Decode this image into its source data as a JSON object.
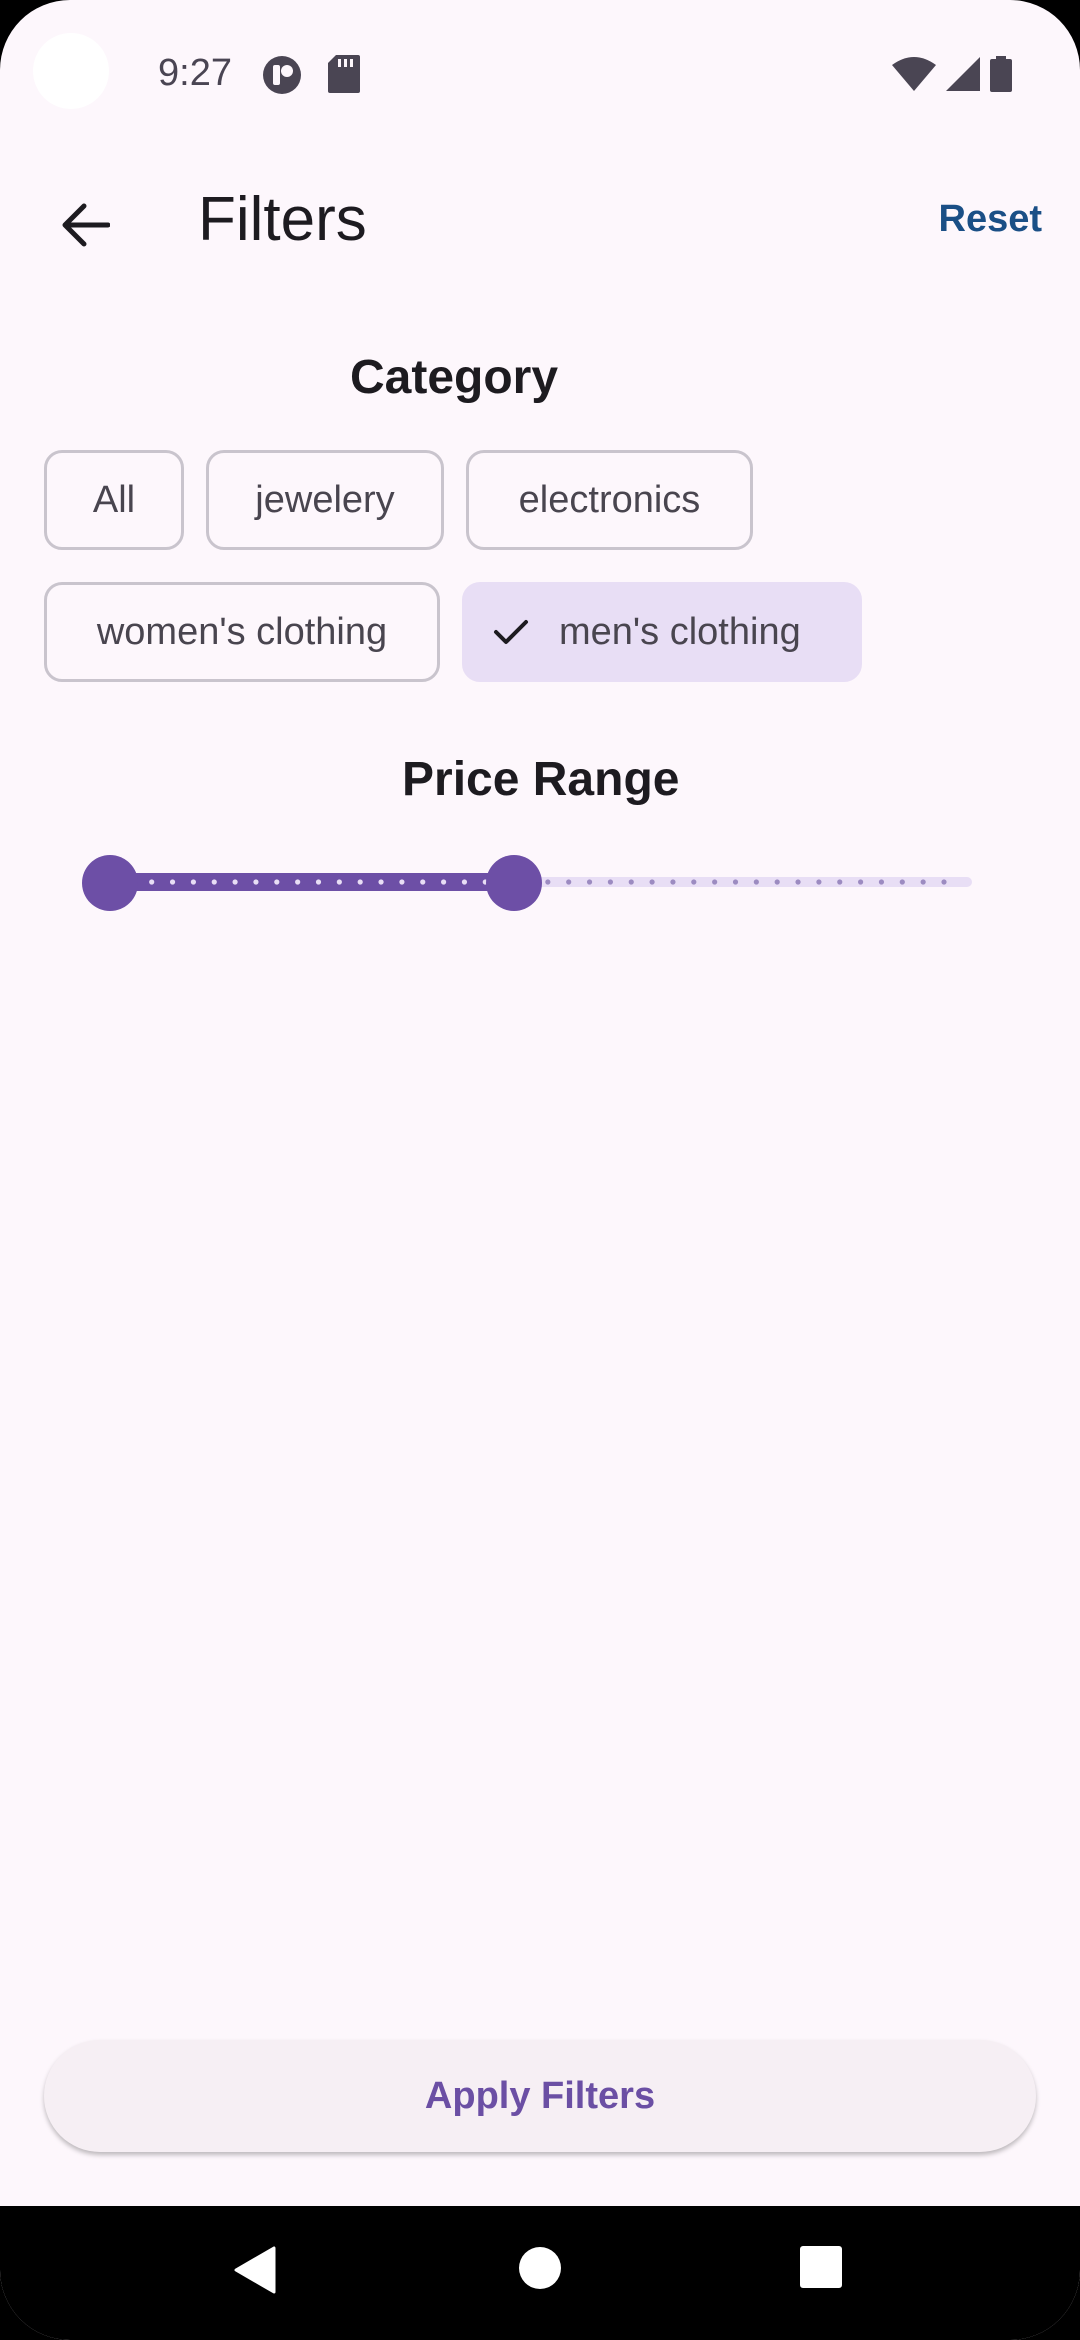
{
  "status_bar": {
    "time": "9:27",
    "icons_left": [
      "app-notification-icon",
      "sd-card-icon"
    ],
    "icons_right": [
      "wifi-icon",
      "signal-icon",
      "battery-icon"
    ]
  },
  "app_bar": {
    "title": "Filters",
    "back_icon": "arrow-back-icon",
    "reset_label": "Reset"
  },
  "category": {
    "title": "Category",
    "chips": [
      {
        "label": "All",
        "selected": false
      },
      {
        "label": "jewelery",
        "selected": false
      },
      {
        "label": "electronics",
        "selected": false
      },
      {
        "label": "women's clothing",
        "selected": false
      },
      {
        "label": "men's clothing",
        "selected": true
      }
    ]
  },
  "price_range": {
    "title": "Price Range",
    "slider": {
      "start_fraction": 0.0,
      "end_fraction": 0.485,
      "steps": 40
    }
  },
  "apply_button": {
    "label": "Apply Filters"
  },
  "colors": {
    "primary": "#6d4fa6",
    "selected_chip_bg": "#e8def5",
    "reset_text": "#1a4f86",
    "background": "#fdf7fc"
  },
  "nav_bar": {
    "icons": [
      "back-triangle-icon",
      "home-circle-icon",
      "recents-square-icon"
    ]
  }
}
